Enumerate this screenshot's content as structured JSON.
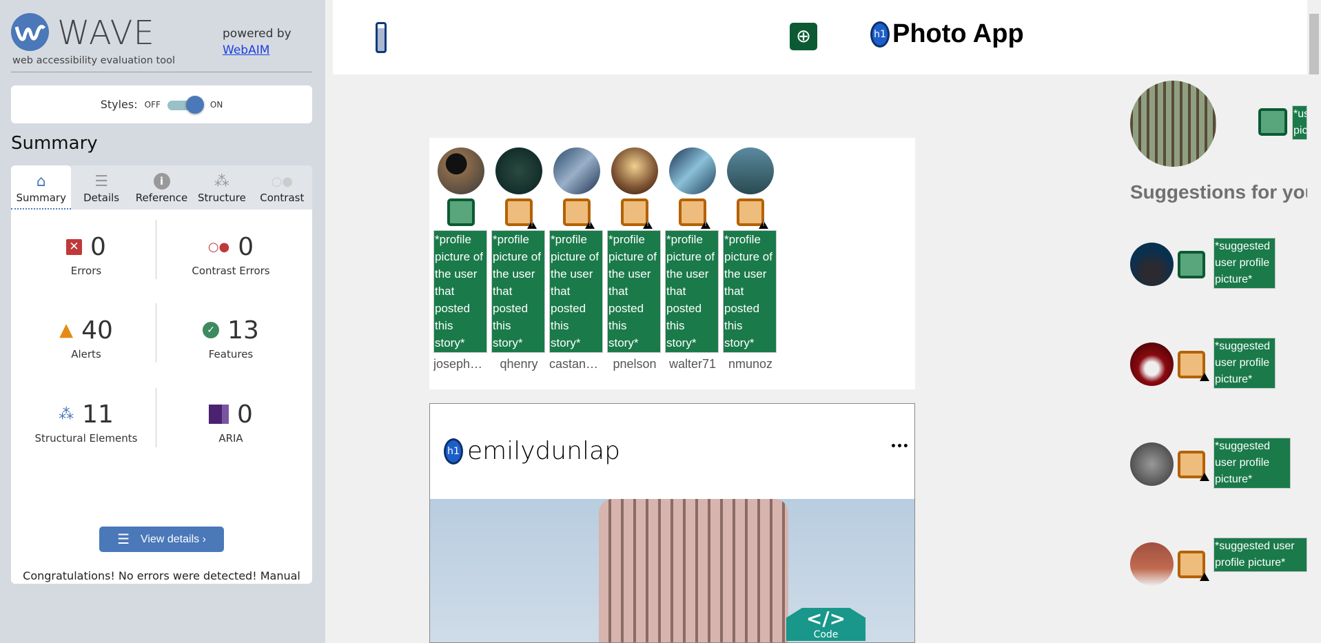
{
  "wave": {
    "title": "WAVE",
    "tagline": "web accessibility evaluation tool",
    "powered_by": "powered by",
    "webaim_link": "WebAIM",
    "styles_label": "Styles:",
    "off": "OFF",
    "on": "ON",
    "summary_heading": "Summary",
    "tabs": [
      {
        "label": "Summary",
        "icon": "home-icon"
      },
      {
        "label": "Details",
        "icon": "list-icon"
      },
      {
        "label": "Reference",
        "icon": "info-icon"
      },
      {
        "label": "Structure",
        "icon": "hierarchy-icon"
      },
      {
        "label": "Contrast",
        "icon": "contrast-icon"
      }
    ],
    "stats": {
      "errors": {
        "value": "0",
        "label": "Errors"
      },
      "contrast": {
        "value": "0",
        "label": "Contrast Errors"
      },
      "alerts": {
        "value": "40",
        "label": "Alerts"
      },
      "features": {
        "value": "13",
        "label": "Features"
      },
      "structural": {
        "value": "11",
        "label": "Structural Elements"
      },
      "aria": {
        "value": "0",
        "label": "ARIA"
      }
    },
    "view_details": "View details ›",
    "congrats": "Congratulations! No errors were detected! Manual testing is still necessary to ensure compliance and optimal accessibility."
  },
  "app": {
    "title": "Photo App",
    "h1_badge": "h1",
    "stories": [
      {
        "alt": "*profile picture of the user that posted this story*",
        "user": "josephacosta",
        "status": "feature"
      },
      {
        "alt": "*profile picture of the user that posted this story*",
        "user": "qhenry",
        "status": "alert"
      },
      {
        "alt": "*profile picture of the user that posted this story*",
        "user": "castanedaj",
        "status": "alert"
      },
      {
        "alt": "*profile picture of the user that posted this story*",
        "user": "pnelson",
        "status": "alert"
      },
      {
        "alt": "*profile picture of the user that posted this story*",
        "user": "walter71",
        "status": "alert"
      },
      {
        "alt": "*profile picture of the user that posted this story*",
        "user": "nmunoz",
        "status": "alert"
      }
    ],
    "post": {
      "username": "emilydunlap",
      "menu": "•••",
      "code_badge_symbol": "</>",
      "code_badge": "Code"
    },
    "profile_alt": "*us pic",
    "suggestions_heading": "Suggestions for you",
    "suggestions": [
      {
        "alt": "*suggested user profile picture*",
        "status": "feature"
      },
      {
        "alt": "*suggested user profile picture*",
        "status": "alert"
      },
      {
        "alt": "*suggested user profile picture*",
        "status": "alert"
      },
      {
        "alt": "*suggested user profile picture*",
        "status": "alert"
      }
    ]
  },
  "colors": {
    "wave_blue": "#4a78b8",
    "feature_green": "#1a7a4a",
    "alert_orange": "#b46200",
    "error_red": "#c0383a"
  }
}
